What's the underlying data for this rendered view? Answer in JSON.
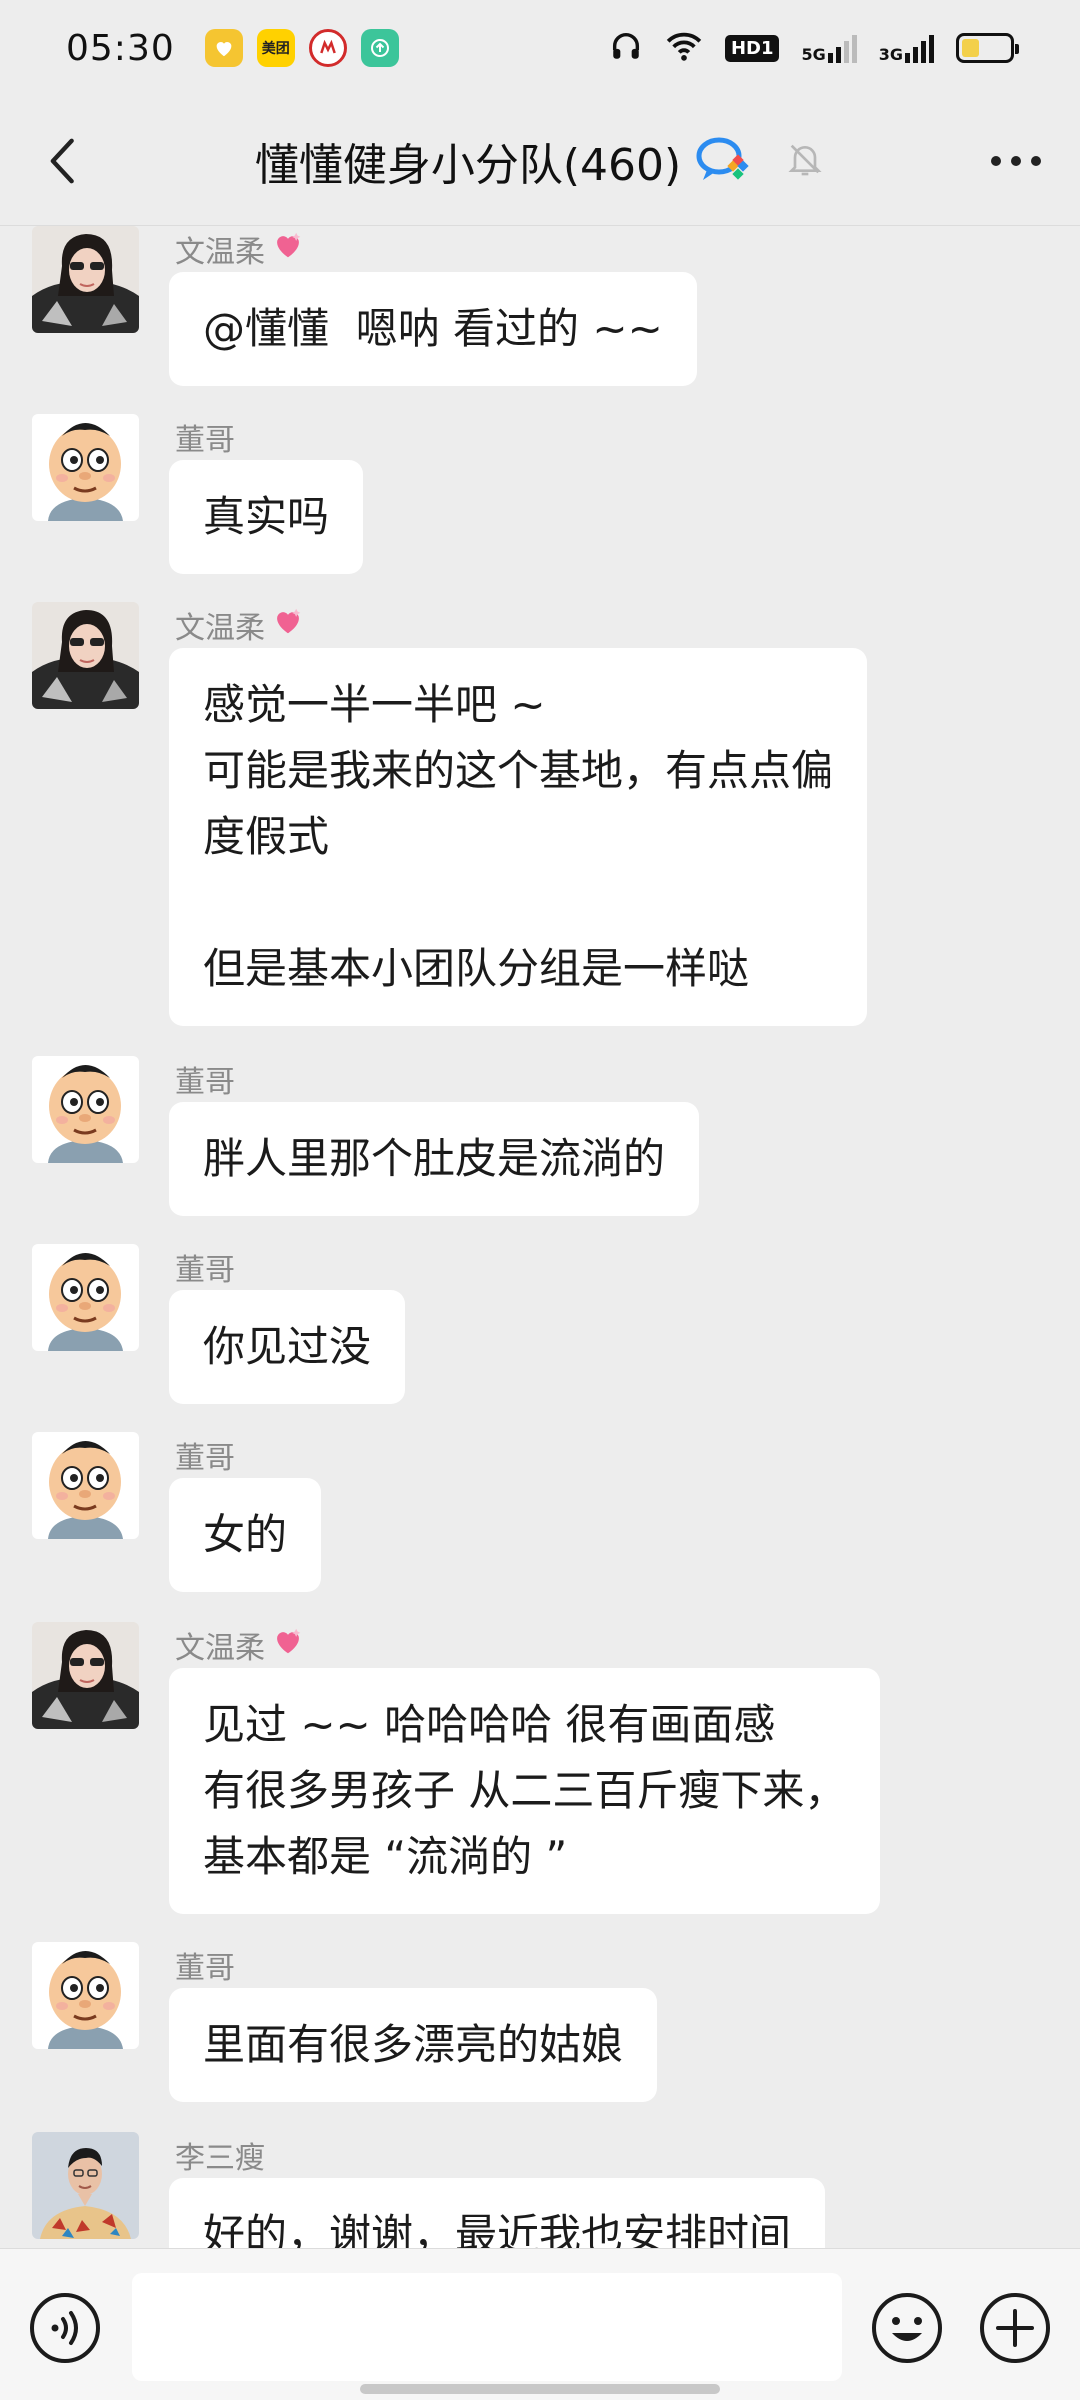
{
  "status_bar": {
    "time": "05:30",
    "app_icons": [
      {
        "name": "heart-app-icon",
        "color": "#f5c531"
      },
      {
        "name": "meituan-app-icon",
        "label": "美团",
        "color": "#ffd100"
      },
      {
        "name": "cmb-bank-app-icon",
        "color": "#d22b2b"
      },
      {
        "name": "upload-app-icon",
        "color": "#3cc59a"
      }
    ],
    "hd_label": "HD1",
    "net1": "5G",
    "net2": "3G"
  },
  "header": {
    "title": "懂懂健身小分队(460)"
  },
  "messages": [
    {
      "sender": "文温柔",
      "avatar": "woman",
      "text": "@懂懂  嗯呐 看过的 ~~"
    },
    {
      "sender": "董哥",
      "avatar": "cartoon",
      "text": "真实吗"
    },
    {
      "sender": "文温柔",
      "avatar": "woman",
      "text": "感觉一半一半吧 ~\n可能是我来的这个基地，有点点偏\n度假式\n\n但是基本小团队分组是一样哒"
    },
    {
      "sender": "董哥",
      "avatar": "cartoon",
      "text": "胖人里那个肚皮是流淌的"
    },
    {
      "sender": "董哥",
      "avatar": "cartoon",
      "text": "你见过没"
    },
    {
      "sender": "董哥",
      "avatar": "cartoon",
      "text": "女的"
    },
    {
      "sender": "文温柔",
      "avatar": "woman",
      "text": "见过 ~~ 哈哈哈哈 很有画面感\n有很多男孩子 从二三百斤瘦下来，\n基本都是 “流淌的 ”"
    },
    {
      "sender": "董哥",
      "avatar": "cartoon",
      "text": "里面有很多漂亮的姑娘"
    },
    {
      "sender": "李三瘦",
      "avatar": "man",
      "text": "好的，谢谢，最近我也安排时间"
    }
  ],
  "colors": {
    "background": "#ededed",
    "bubble": "#ffffff",
    "sender_name": "#8a8a8a",
    "heart": "#f06292"
  }
}
